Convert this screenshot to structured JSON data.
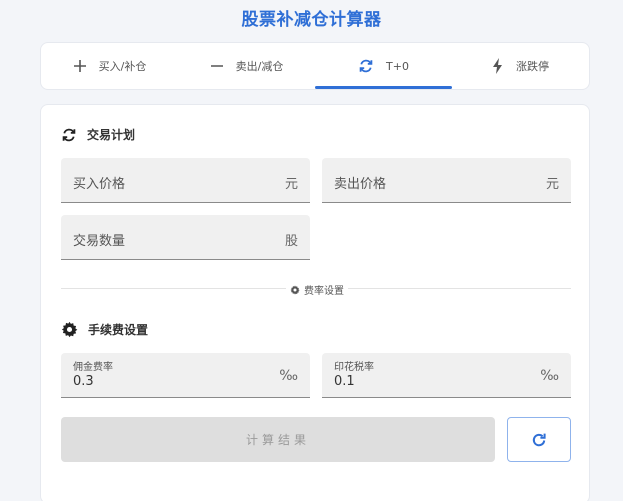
{
  "app": {
    "title": "股票补减仓计算器"
  },
  "tabs": [
    {
      "label": "买入/补仓",
      "icon": "plus-icon"
    },
    {
      "label": "卖出/减仓",
      "icon": "minus-icon"
    },
    {
      "label": "T+0",
      "icon": "sync-icon",
      "active": true
    },
    {
      "label": "涨跌停",
      "icon": "bolt-icon"
    }
  ],
  "trade": {
    "title": "交易计划",
    "buy_price": {
      "placeholder": "买入价格",
      "unit": "元"
    },
    "sell_price": {
      "placeholder": "卖出价格",
      "unit": "元"
    },
    "quantity": {
      "placeholder": "交易数量",
      "unit": "股"
    }
  },
  "divider": {
    "label": "费率设置"
  },
  "fees": {
    "title": "手续费设置",
    "commission": {
      "label": "佣金费率",
      "value": "0.3",
      "unit": "‰"
    },
    "stamp_tax": {
      "label": "印花税率",
      "value": "0.1",
      "unit": "‰"
    }
  },
  "actions": {
    "calculate_label": "计算结果"
  },
  "colors": {
    "accent": "#2f6fd6",
    "tab_icon": "#555555",
    "disabled_bg": "#dedede"
  }
}
